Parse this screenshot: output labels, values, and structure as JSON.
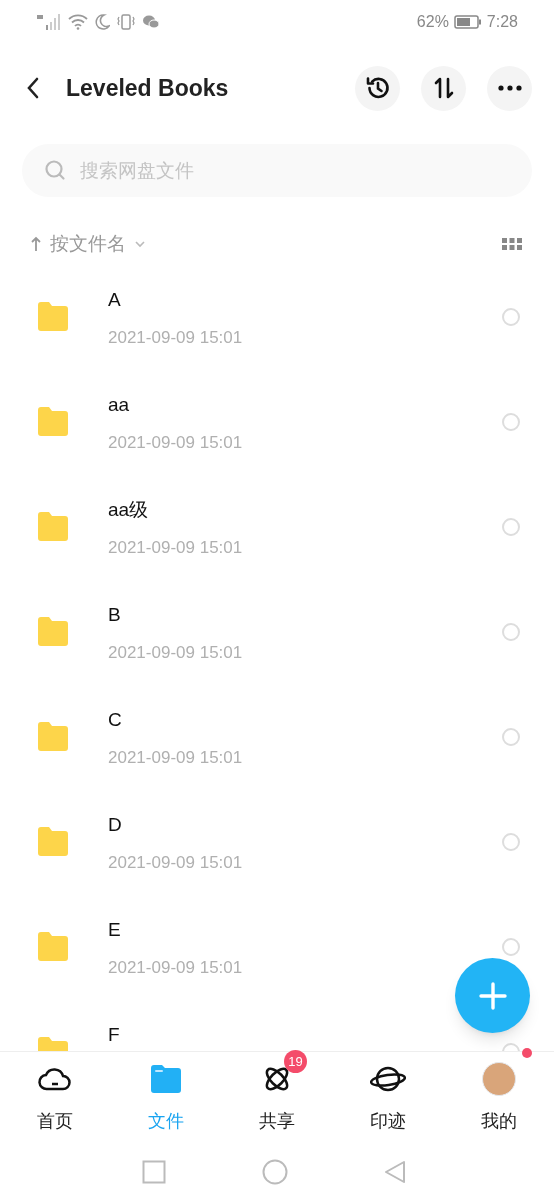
{
  "status_bar": {
    "battery": "62%",
    "time": "7:28"
  },
  "header": {
    "title": "Leveled Books"
  },
  "search": {
    "placeholder": "搜索网盘文件"
  },
  "sort": {
    "label": "按文件名"
  },
  "files": [
    {
      "name": "A",
      "date": "2021-09-09  15:01",
      "selected": false
    },
    {
      "name": "aa",
      "date": "2021-09-09  15:01",
      "selected": false
    },
    {
      "name": "aa级",
      "date": "2021-09-09  15:01",
      "selected": false
    },
    {
      "name": "B",
      "date": "2021-09-09  15:01",
      "selected": false
    },
    {
      "name": "C",
      "date": "2021-09-09  15:01",
      "selected": false
    },
    {
      "name": "D",
      "date": "2021-09-09  15:01",
      "selected": false
    },
    {
      "name": "E",
      "date": "2021-09-09  15:01",
      "selected": false
    },
    {
      "name": "F",
      "selected": false
    }
  ],
  "tabs": [
    {
      "kind": "home",
      "label": "首页",
      "selected": false
    },
    {
      "kind": "files",
      "label": "文件",
      "selected": true
    },
    {
      "kind": "share",
      "label": "共享",
      "selected": false,
      "badge": "19"
    },
    {
      "kind": "trace",
      "label": "印迹",
      "selected": false
    },
    {
      "kind": "me",
      "label": "我的",
      "selected": false,
      "dot": true
    }
  ]
}
